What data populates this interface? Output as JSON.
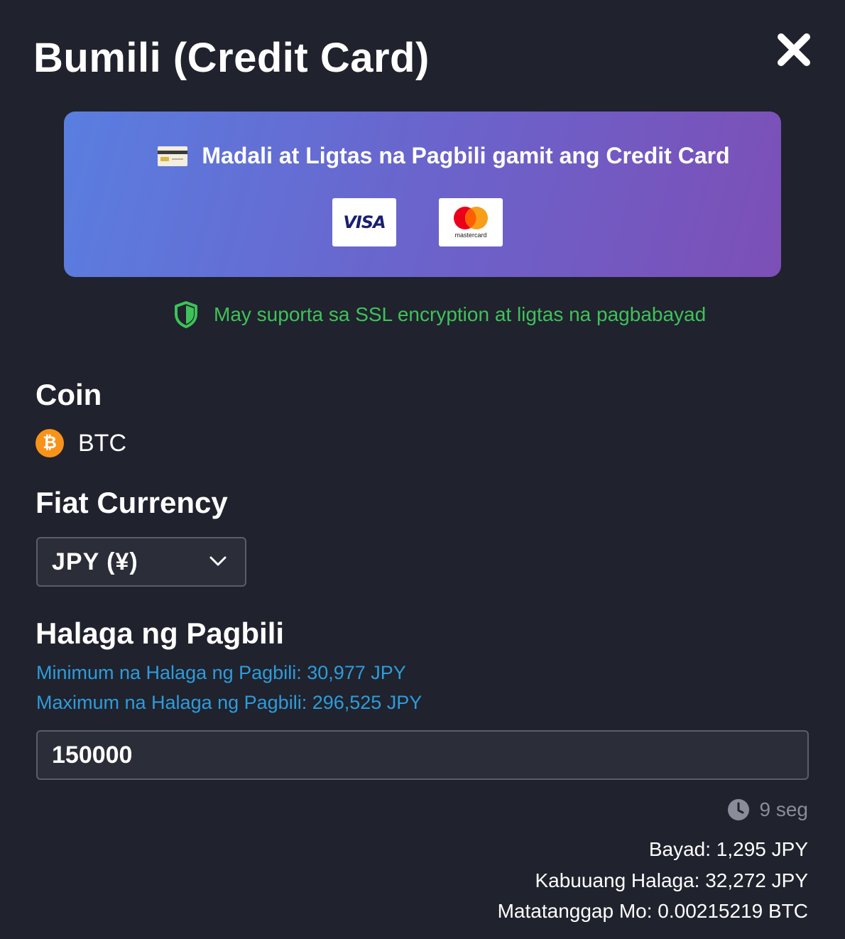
{
  "dialog": {
    "title": "Bumili (Credit Card)"
  },
  "banner": {
    "headline": "Madali at Ligtas na Pagbili gamit ang Credit Card",
    "card_icon": "credit-card-icon",
    "logos": [
      {
        "name": "visa-logo",
        "text": "VISA"
      },
      {
        "name": "mastercard-logo",
        "text": "mastercard"
      }
    ]
  },
  "security": {
    "icon": "shield-icon",
    "text": "May suporta sa SSL encryption at ligtas na pagbabayad",
    "color": "#3ec25a"
  },
  "coin": {
    "label": "Coin",
    "icon": "bitcoin-icon",
    "icon_glyph": "₿",
    "name": "BTC"
  },
  "fiat": {
    "label": "Fiat Currency",
    "selected": "JPY (¥)"
  },
  "amount": {
    "label": "Halaga ng Pagbili",
    "min_text": "Minimum na Halaga ng Pagbili: 30,977 JPY",
    "max_text": "Maximum na Halaga ng Pagbili: 296,525 JPY",
    "value": "150000"
  },
  "timer": {
    "icon": "clock-icon",
    "text": "9 seg"
  },
  "summary": {
    "fee": "Bayad: 1,295 JPY",
    "total": "Kabuuang Halaga: 32,272 JPY",
    "receive": "Matatanggap Mo: 0.00215219 BTC"
  },
  "colors": {
    "background": "#20222d",
    "link": "#2d9cdb",
    "bitcoin": "#f7931a",
    "muted": "#8a8d99"
  }
}
